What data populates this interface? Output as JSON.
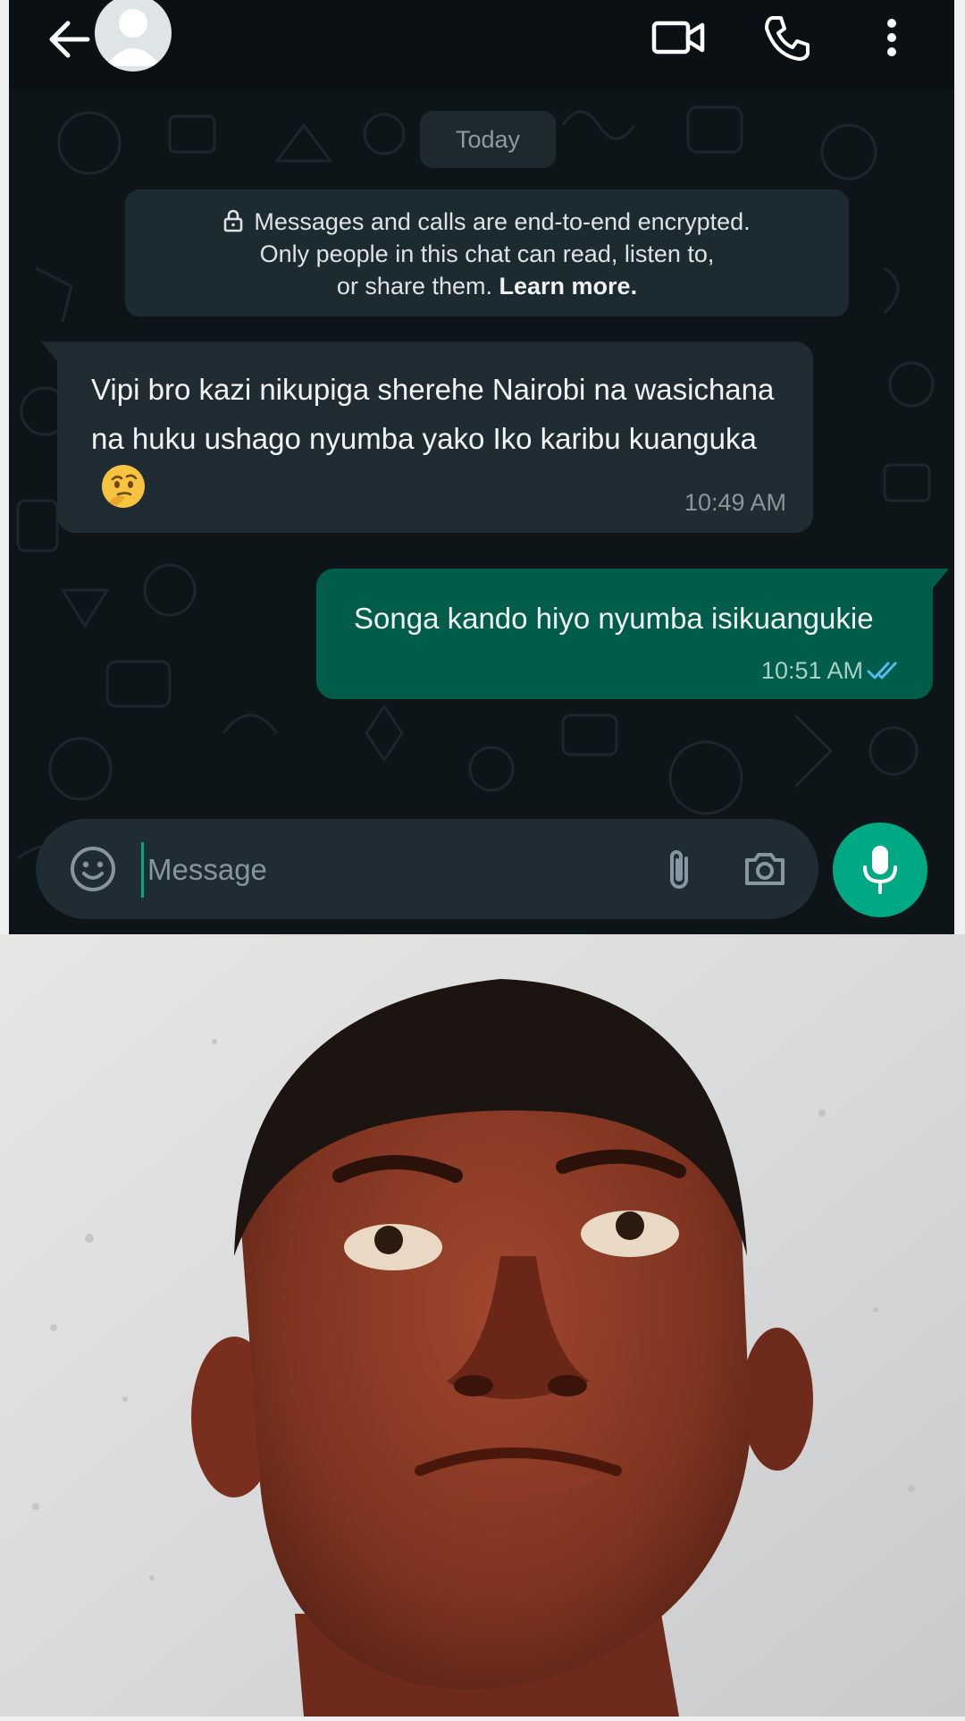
{
  "chat": {
    "date_chip": "Today",
    "encryption": {
      "line1": "Messages and calls are end-to-end encrypted.",
      "line2": "Only people in this chat can read, listen to,",
      "line3_prefix": "or share them.",
      "learn_more": "Learn more."
    },
    "messages": [
      {
        "direction": "incoming",
        "text": "Vipi bro kazi nikupiga sherehe Nairobi na wasichana na huku ushago nyumba yako Iko karibu kuanguka",
        "emoji": "thinking-face",
        "time": "10:49 AM"
      },
      {
        "direction": "outgoing",
        "text": "Songa kando hiyo nyumba isikuangukie",
        "time": "10:51 AM",
        "status": "read"
      }
    ],
    "composer": {
      "placeholder": "Message"
    }
  },
  "icons": {
    "back": "arrow-left-icon",
    "avatar": "default-avatar-icon",
    "video": "video-camera-icon",
    "call": "phone-icon",
    "menu": "more-vertical-icon",
    "emoji": "smiley-icon",
    "attach": "paperclip-icon",
    "camera": "camera-icon",
    "mic": "microphone-icon"
  },
  "colors": {
    "outgoing_bubble": "#005c4b",
    "incoming_bubble": "#202c33",
    "accent": "#00a884",
    "read_ticks": "#53bdeb"
  }
}
